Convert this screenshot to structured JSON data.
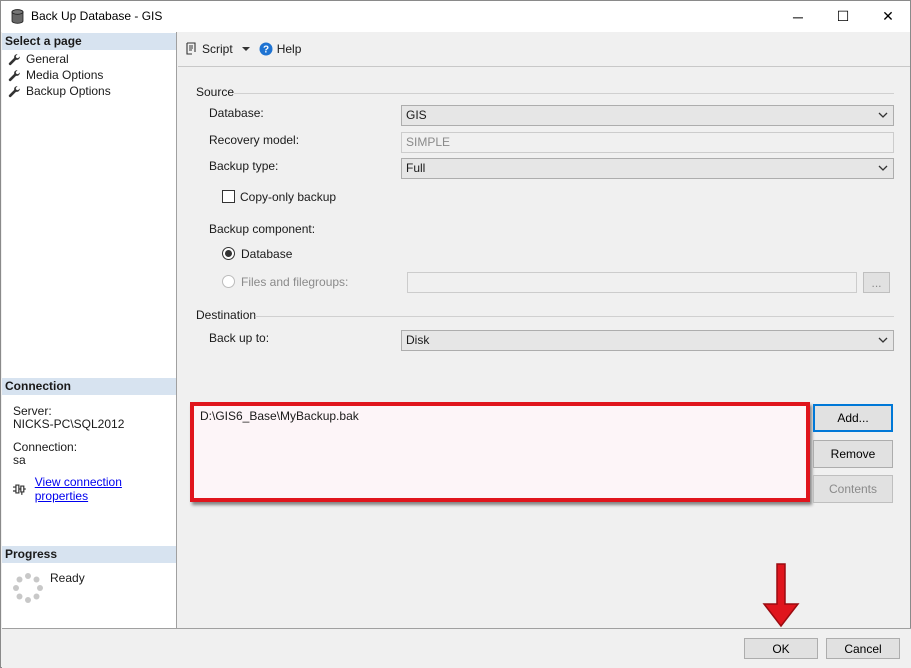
{
  "window": {
    "title": "Back Up Database - GIS",
    "controls": {
      "minimize": "─",
      "maximize": "☐",
      "close": "✕"
    }
  },
  "left_pane": {
    "select_page_header": "Select a page",
    "pages": [
      {
        "label": "General",
        "icon": "wrench-icon"
      },
      {
        "label": "Media Options",
        "icon": "wrench-icon"
      },
      {
        "label": "Backup Options",
        "icon": "wrench-icon"
      }
    ],
    "connection_header": "Connection",
    "server_label": "Server:",
    "server_value": "NICKS-PC\\SQL2012",
    "connection_label": "Connection:",
    "connection_value": "sa",
    "view_connection_link": "View connection properties",
    "progress_header": "Progress",
    "progress_status": "Ready"
  },
  "toolbar": {
    "script_label": "Script",
    "help_label": "Help"
  },
  "source": {
    "group_label": "Source",
    "database_label": "Database:",
    "database_value": "GIS",
    "recovery_model_label": "Recovery model:",
    "recovery_model_value": "SIMPLE",
    "backup_type_label": "Backup type:",
    "backup_type_value": "Full",
    "copy_only_label": "Copy-only backup",
    "copy_only_checked": false,
    "backup_component_label": "Backup component:",
    "component_database_label": "Database",
    "component_files_label": "Files and filegroups:",
    "component_selected": "Database",
    "files_browse_label": "..."
  },
  "destination": {
    "group_label": "Destination",
    "back_up_to_label": "Back up to:",
    "back_up_to_value": "Disk",
    "paths": [
      "D:\\GIS6_Base\\MyBackup.bak"
    ],
    "add_button": "Add...",
    "remove_button": "Remove",
    "contents_button": "Contents"
  },
  "footer": {
    "ok_button": "OK",
    "cancel_button": "Cancel"
  },
  "colors": {
    "highlight_border": "#e0151d",
    "header_background": "#d7e3f0",
    "default_button_border": "#0078d7",
    "arrow": "#e0151d"
  }
}
